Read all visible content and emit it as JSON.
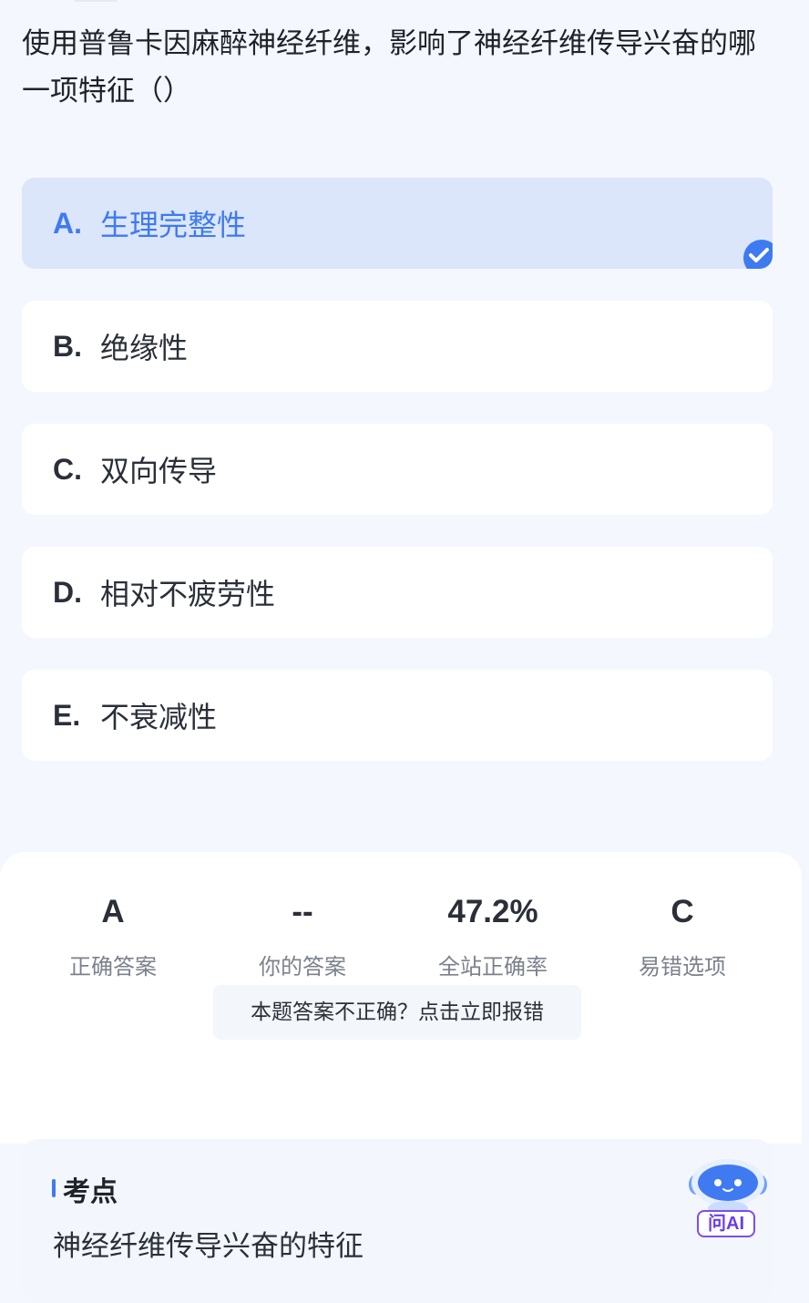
{
  "question": {
    "text": "使用普鲁卡因麻醉神经纤维，影响了神经纤维传导兴奋的哪一项特征（）"
  },
  "options": [
    {
      "letter": "A.",
      "text": "生理完整性",
      "selected": true
    },
    {
      "letter": "B.",
      "text": "绝缘性",
      "selected": false
    },
    {
      "letter": "C.",
      "text": "双向传导",
      "selected": false
    },
    {
      "letter": "D.",
      "text": "相对不疲劳性",
      "selected": false
    },
    {
      "letter": "E.",
      "text": "不衰减性",
      "selected": false
    }
  ],
  "stats": {
    "correct_answer": {
      "value": "A",
      "label": "正确答案"
    },
    "your_answer": {
      "value": "--",
      "label": "你的答案"
    },
    "site_accuracy": {
      "value": "47.2%",
      "label": "全站正确率"
    },
    "common_wrong": {
      "value": "C",
      "label": "易错选项"
    }
  },
  "report_button": "本题答案不正确？点击立即报错",
  "key_point": {
    "title": "考点",
    "content": "神经纤维传导兴奋的特征"
  },
  "ai_button": {
    "label": "问AI",
    "icon": "robot-icon"
  },
  "colors": {
    "accent": "#3f7af1",
    "selected_bg": "#dbe6fb",
    "page_bg": "#f4f7fd",
    "ai_purple": "#7c4df0"
  }
}
